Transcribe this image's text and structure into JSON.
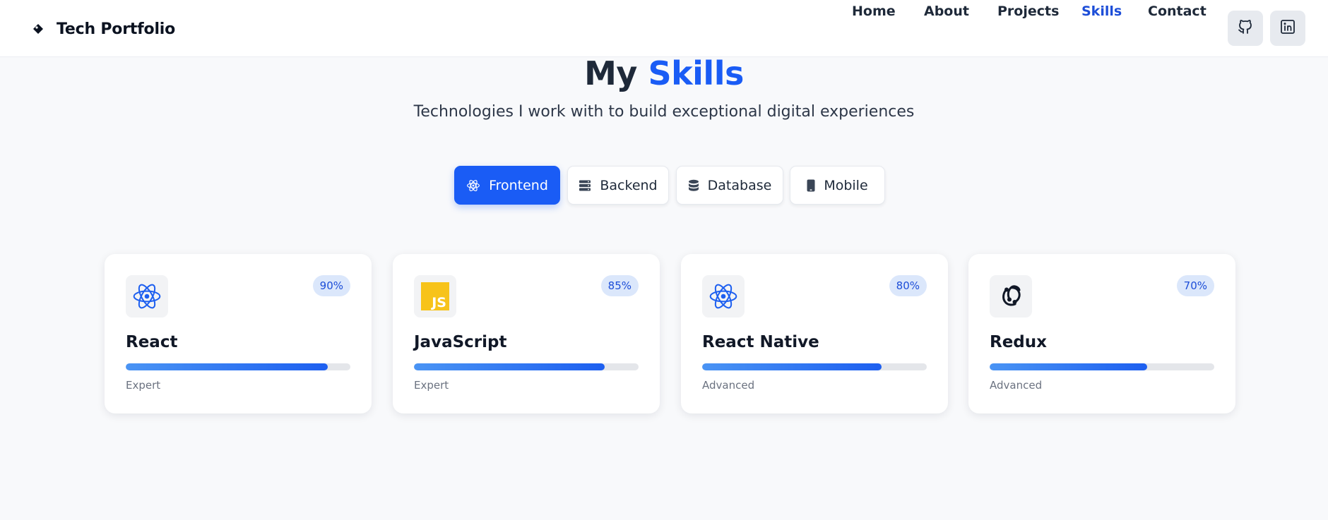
{
  "header": {
    "brand": "Tech Portfolio",
    "brand_icon": "tag-icon",
    "nav": [
      {
        "label": "Home",
        "active": false
      },
      {
        "label": "About",
        "active": false
      },
      {
        "label": "Projects",
        "active": false
      },
      {
        "label": "Skills",
        "active": true
      },
      {
        "label": "Contact",
        "active": false
      }
    ],
    "social": [
      {
        "icon": "github-icon"
      },
      {
        "icon": "linkedin-icon"
      }
    ]
  },
  "hero": {
    "title_prefix": "My",
    "title_accent": "Skills",
    "subtitle": "Technologies I work with to build exceptional digital experiences"
  },
  "tabs": [
    {
      "label": "Frontend",
      "icon": "react-atom-icon",
      "active": true
    },
    {
      "label": "Backend",
      "icon": "server-icon",
      "active": false
    },
    {
      "label": "Database",
      "icon": "database-icon",
      "active": false
    },
    {
      "label": "Mobile",
      "icon": "mobile-phone-icon",
      "active": false
    }
  ],
  "skills": [
    {
      "name": "React",
      "percent_label": "90%",
      "percent": 90,
      "level": "Expert",
      "icon": "react-atom-icon"
    },
    {
      "name": "JavaScript",
      "percent_label": "85%",
      "percent": 85,
      "level": "Expert",
      "icon": "javascript-logo-icon",
      "icon_text": "JS"
    },
    {
      "name": "React Native",
      "percent_label": "80%",
      "percent": 80,
      "level": "Advanced",
      "icon": "react-atom-icon"
    },
    {
      "name": "Redux",
      "percent_label": "70%",
      "percent": 70,
      "level": "Advanced",
      "icon": "redux-logo-icon"
    }
  ],
  "colors": {
    "accent": "#1a5cf5",
    "nav_active": "#1d4ed8",
    "background": "#f8f9fb",
    "badge_bg": "#dbe7fb",
    "js_yellow": "#f7c31a"
  }
}
